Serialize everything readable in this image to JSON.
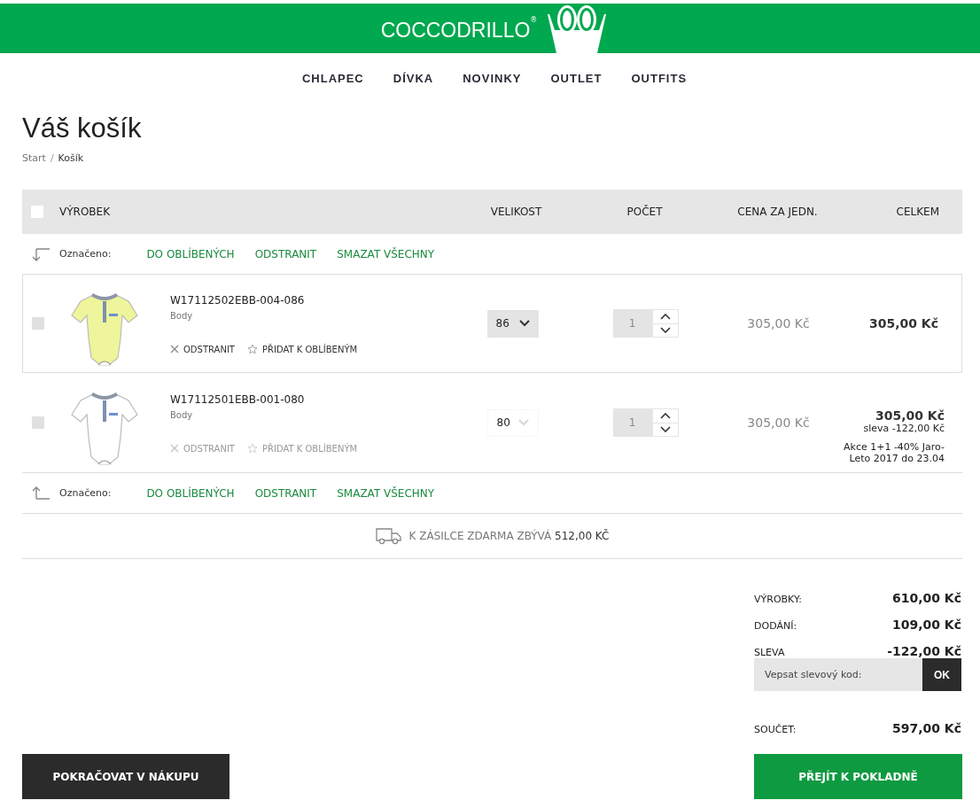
{
  "header": {
    "logo": "COCCODRILLO",
    "logo_mark": "®"
  },
  "nav": [
    "CHLAPEC",
    "DÍVKA",
    "NOVINKY",
    "OUTLET",
    "OUTFITS"
  ],
  "page_title": "Váš košík",
  "breadcrumb_separator": "/",
  "breadcrumb": [
    {
      "label": "Start",
      "current": false
    },
    {
      "label": "Košík",
      "current": true
    }
  ],
  "table": {
    "select_all_checked": false,
    "columns": [
      "VÝROBEK",
      "VELIKOST",
      "POČET",
      "CENA ZA JEDN.",
      "CELKEM"
    ]
  },
  "bulk_actions_top": {
    "label": "Označeno:",
    "actions": [
      "DO OBLÍBENÝCH",
      "ODSTRANIT",
      "SMAZAT VŠECHNY"
    ]
  },
  "items": [
    {
      "code": "W17112502EBB-004-086",
      "name": "Body",
      "checked": false,
      "highlighted": true,
      "remove": "ODSTRANIT",
      "favorite": "PŘIDAT K OBLÍBENÝM",
      "size": "86",
      "quantity": "1",
      "unit_price": "305,00 Kč",
      "total": "305,00 Kč"
    },
    {
      "code": "W17112501EBB-001-080",
      "name": "Body",
      "checked": false,
      "highlighted": false,
      "remove": "ODSTRANIT",
      "favorite": "PŘIDAT K OBLÍBENÝM",
      "size": "80",
      "quantity": "1",
      "unit_price": "305,00 Kč",
      "total": "305,00 Kč",
      "discount": "sleva -122,00 Kč",
      "promo": "Akce 1+1 -40% Jaro-Leto 2017 do 23.04"
    }
  ],
  "bulk_actions_bottom": {
    "label": "Označeno:",
    "actions": [
      "DO OBLÍBENÝCH",
      "ODSTRANIT",
      "SMAZAT VŠECHNY"
    ]
  },
  "free_shipping": {
    "text": "K ZÁSILCE ZDARMA ZBÝVÁ",
    "amount": "512,00 KČ"
  },
  "summary": [
    {
      "label": "VÝROBKY:",
      "value": "610,00 Kč"
    },
    {
      "label": "DODÁNÍ:",
      "value": "109,00 Kč"
    },
    {
      "label": "SLEVA",
      "value": "-122,00 Kč"
    }
  ],
  "coupon": {
    "placeholder": "Vepsat slevový kod:",
    "button": "OK"
  },
  "total": {
    "label": "SOUČET:",
    "value": "597,00 Kč"
  },
  "continue_button": "POKRAČOVAT V NÁKUPU",
  "checkout_button": "PŘEJÍT K POKLADNĚ"
}
